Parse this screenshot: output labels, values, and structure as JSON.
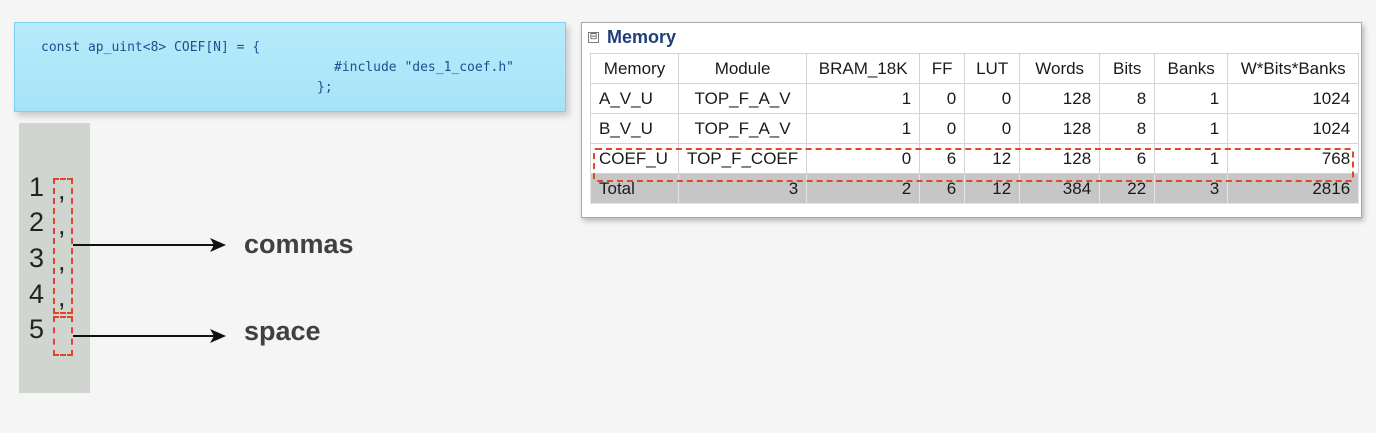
{
  "code": {
    "line1": "const ap_uint<8> COEF[N] = {",
    "line2": "#include \"des_1_coef.h\"",
    "line3": "};"
  },
  "numbers": {
    "items": [
      "1",
      "2",
      "3",
      "4",
      "5"
    ],
    "commas": [
      ",",
      ",",
      ",",
      ","
    ]
  },
  "annotations": {
    "commas_label": "commas",
    "space_label": "space"
  },
  "memory_panel": {
    "title": "Memory",
    "collapse_glyph": "⊟",
    "columns": [
      "Memory",
      "Module",
      "BRAM_18K",
      "FF",
      "LUT",
      "Words",
      "Bits",
      "Banks",
      "W*Bits*Banks"
    ],
    "rows": [
      [
        "A_V_U",
        "TOP_F_A_V",
        "1",
        "0",
        "0",
        "128",
        "8",
        "1",
        "1024"
      ],
      [
        "B_V_U",
        "TOP_F_A_V",
        "1",
        "0",
        "0",
        "128",
        "8",
        "1",
        "1024"
      ],
      [
        "COEF_U",
        "TOP_F_COEF",
        "0",
        "6",
        "12",
        "128",
        "6",
        "1",
        "768"
      ]
    ],
    "total": [
      "Total",
      "3",
      "2",
      "6",
      "12",
      "384",
      "22",
      "3",
      "2816"
    ],
    "highlight_color": "#e2452a"
  }
}
